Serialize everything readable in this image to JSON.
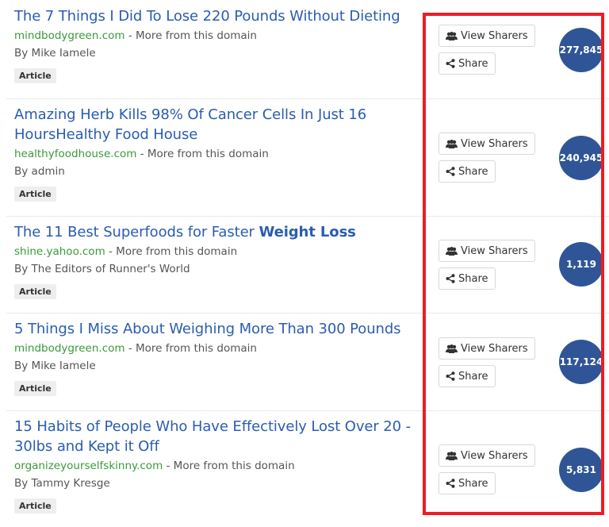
{
  "items": [
    {
      "title": "The 7 Things I Did To Lose 220 Pounds Without Dieting",
      "title_bold": "",
      "domain": "mindbodygreen.com",
      "more_text": "- More from this domain",
      "author": "By Mike Iamele",
      "badge": "Article",
      "view_sharers_label": "View Sharers",
      "share_label": "Share",
      "share_count": "277,845"
    },
    {
      "title": "Amazing Herb Kills 98% Of Cancer Cells In Just 16 HoursHealthy Food House",
      "title_bold": "",
      "domain": "healthyfoodhouse.com",
      "more_text": "- More from this domain",
      "author": "By admin",
      "badge": "Article",
      "view_sharers_label": "View Sharers",
      "share_label": "Share",
      "share_count": "240,945"
    },
    {
      "title": "The 11 Best Superfoods for Faster ",
      "title_bold": "Weight Loss",
      "domain": "shine.yahoo.com",
      "more_text": "- More from this domain",
      "author": "By The Editors of Runner's World",
      "badge": "Article",
      "view_sharers_label": "View Sharers",
      "share_label": "Share",
      "share_count": "1,119"
    },
    {
      "title": "5 Things I Miss About Weighing More Than 300 Pounds",
      "title_bold": "",
      "domain": "mindbodygreen.com",
      "more_text": "- More from this domain",
      "author": "By Mike Iamele",
      "badge": "Article",
      "view_sharers_label": "View Sharers",
      "share_label": "Share",
      "share_count": "117,124"
    },
    {
      "title": "15 Habits of People Who Have Effectively Lost Over 20 - 30lbs and Kept it Off",
      "title_bold": "",
      "domain": "organizeyourselfskinny.com",
      "more_text": "- More from this domain",
      "author": "By Tammy Kresge",
      "badge": "Article",
      "view_sharers_label": "View Sharers",
      "share_label": "Share",
      "share_count": "5,831"
    }
  ],
  "colors": {
    "title": "#2a5db0",
    "domain": "#3a9a3a",
    "count_circle": "#2f5597",
    "highlight_box": "#ee1c24"
  }
}
